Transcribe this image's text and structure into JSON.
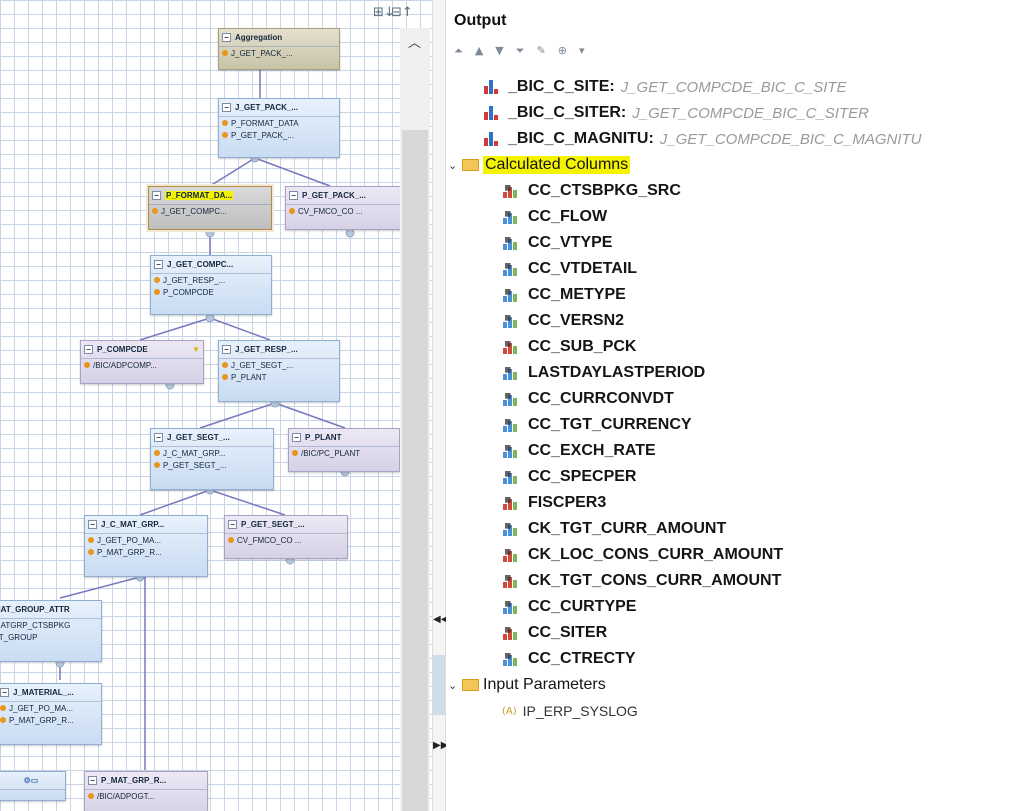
{
  "canvas": {
    "expand_all_icon": "expand-all-icon",
    "collapse_all_icon": "collapse-all-icon",
    "nodes": [
      {
        "header": "Aggregation",
        "rows": [
          "J_GET_PACK_..."
        ]
      },
      {
        "header": "J_GET_PACK_...",
        "rows": [
          "P_FORMAT_DATA",
          "P_GET_PACK_..."
        ]
      },
      {
        "header": "P_FORMAT_DA...",
        "rows": [
          "J_GET_COMPC..."
        ]
      },
      {
        "header": "P_GET_PACK_...",
        "rows": [
          "CV_FMCO_CO ..."
        ]
      },
      {
        "header": "J_GET_COMPC...",
        "rows": [
          "J_GET_RESP_...",
          "P_COMPCDE"
        ]
      },
      {
        "header": "P_COMPCDE",
        "rows": [
          "/BIC/ADPCOMP..."
        ]
      },
      {
        "header": "J_GET_RESP_...",
        "rows": [
          "J_GET_SEGT_...",
          "P_PLANT"
        ]
      },
      {
        "header": "J_GET_SEGT_...",
        "rows": [
          "J_C_MAT_GRP...",
          "P_GET_SEGT_..."
        ]
      },
      {
        "header": "P_PLANT",
        "rows": [
          "/BIC/PC_PLANT"
        ]
      },
      {
        "header": "J_C_MAT_GRP...",
        "rows": [
          "J_GET_PO_MA...",
          "P_MAT_GRP_R..."
        ]
      },
      {
        "header": "P_GET_SEGT_...",
        "rows": [
          "CV_FMCO_CO ..."
        ]
      },
      {
        "header": "MAT_GROUP_ATTR",
        "rows": [
          "MATGRP_CTSBPKG",
          "AT_GROUP"
        ]
      },
      {
        "header": "J_MATERIAL_...",
        "rows": [
          "J_GET_PO_MA...",
          "P_MAT_GRP_R..."
        ]
      },
      {
        "header": "P_MAT_GRP_R...",
        "rows": [
          "/BIC/ADPOGT..."
        ]
      }
    ]
  },
  "output": {
    "title": "Output",
    "toolbar": [
      "⏶",
      "▲",
      "▼",
      "⏷",
      "✎",
      "⊕",
      "▾"
    ],
    "attributes": [
      {
        "name": "_BIC_C_SITE:",
        "source": "J_GET_COMPCDE_BIC_C_SITE"
      },
      {
        "name": "_BIC_C_SITER:",
        "source": "J_GET_COMPCDE_BIC_C_SITER"
      },
      {
        "name": "_BIC_C_MAGNITU:",
        "source": "J_GET_COMPCDE_BIC_C_MAGNITU"
      }
    ],
    "calc_group_label": "Calculated Columns",
    "calc_columns": [
      {
        "name": "CC_CTSBPKG_SRC",
        "kind": "attribute"
      },
      {
        "name": "CC_FLOW",
        "kind": "measure"
      },
      {
        "name": "CC_VTYPE",
        "kind": "measure"
      },
      {
        "name": "CC_VTDETAIL",
        "kind": "measure"
      },
      {
        "name": "CC_METYPE",
        "kind": "measure"
      },
      {
        "name": "CC_VERSN2",
        "kind": "measure"
      },
      {
        "name": "CC_SUB_PCK",
        "kind": "attribute"
      },
      {
        "name": "LASTDAYLASTPERIOD",
        "kind": "measure"
      },
      {
        "name": "CC_CURRCONVDT",
        "kind": "measure"
      },
      {
        "name": "CC_TGT_CURRENCY",
        "kind": "measure"
      },
      {
        "name": "CC_EXCH_RATE",
        "kind": "measure"
      },
      {
        "name": "CC_SPECPER",
        "kind": "measure"
      },
      {
        "name": "FISCPER3",
        "kind": "attribute"
      },
      {
        "name": "CK_TGT_CURR_AMOUNT",
        "kind": "measure"
      },
      {
        "name": "CK_LOC_CONS_CURR_AMOUNT",
        "kind": "attribute"
      },
      {
        "name": "CK_TGT_CONS_CURR_AMOUNT",
        "kind": "attribute"
      },
      {
        "name": "CC_CURTYPE",
        "kind": "measure"
      },
      {
        "name": "CC_SITER",
        "kind": "attribute"
      },
      {
        "name": "CC_CTRECTY",
        "kind": "measure"
      }
    ],
    "input_group_label": "Input Parameters",
    "input_params": [
      "IP_ERP_SYSLOG"
    ]
  }
}
